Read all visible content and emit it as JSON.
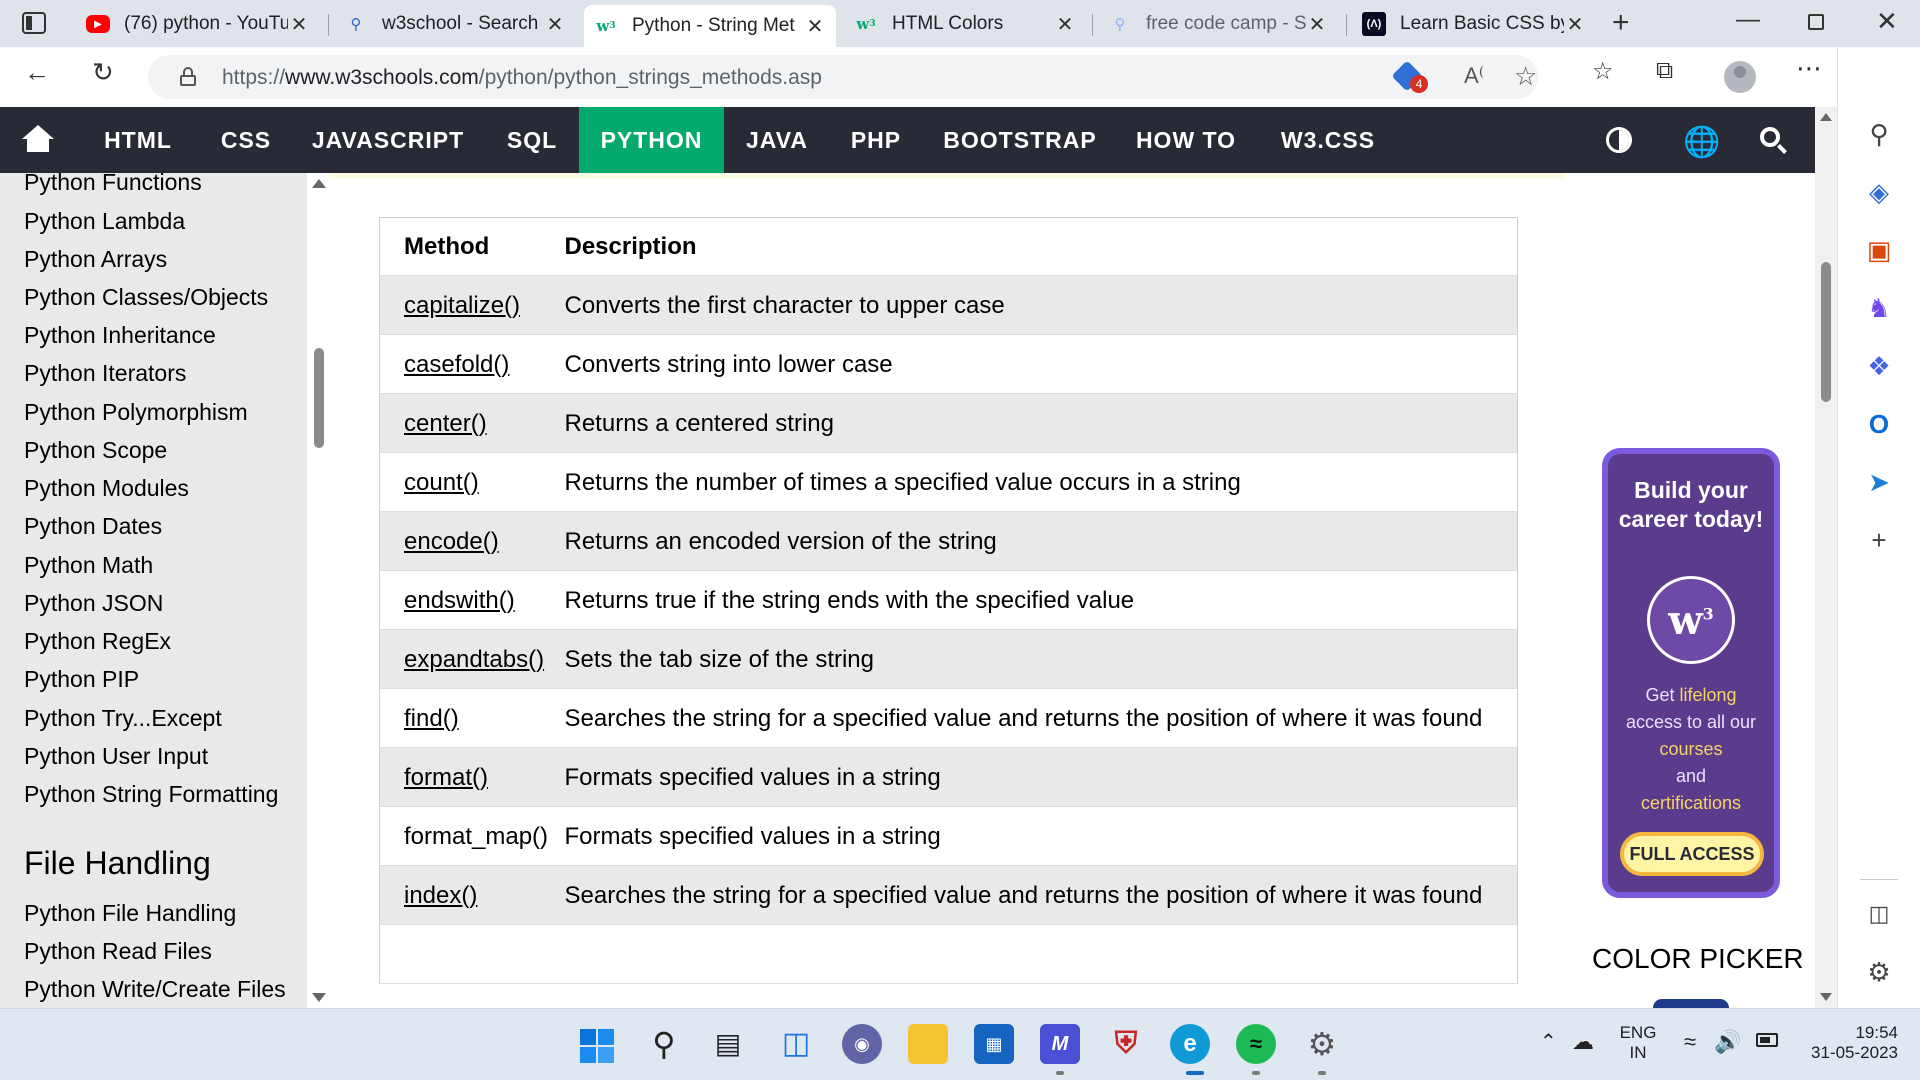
{
  "browser": {
    "tabs": [
      {
        "favicon": "youtube-icon",
        "title": "(76) python - YouTu",
        "active": false
      },
      {
        "favicon": "search-icon",
        "title": "w3school - Search",
        "active": false
      },
      {
        "favicon": "w3schools-icon",
        "title": "Python - String Met",
        "active": true
      },
      {
        "favicon": "w3schools-icon",
        "title": "HTML Colors",
        "active": false
      },
      {
        "favicon": "search-icon",
        "title": "free code camp - Se",
        "active": false
      },
      {
        "favicon": "freecodecamp-icon",
        "title": "Learn Basic CSS by",
        "active": false
      }
    ],
    "url_prefix": "https://",
    "url_host": "www.w3schools.com",
    "url_path": "/python/python_strings_methods.asp",
    "extension_badge": "4"
  },
  "topnav": {
    "items": [
      "HTML",
      "CSS",
      "JAVASCRIPT",
      "SQL",
      "PYTHON",
      "JAVA",
      "PHP",
      "BOOTSTRAP",
      "HOW TO",
      "W3.CSS"
    ],
    "active": "PYTHON"
  },
  "sidebar": {
    "links": [
      "Python Functions",
      "Python Lambda",
      "Python Arrays",
      "Python Classes/Objects",
      "Python Inheritance",
      "Python Iterators",
      "Python Polymorphism",
      "Python Scope",
      "Python Modules",
      "Python Dates",
      "Python Math",
      "Python JSON",
      "Python RegEx",
      "Python PIP",
      "Python Try...Except",
      "Python User Input",
      "Python String Formatting"
    ],
    "section_heading": "File Handling",
    "section_links": [
      "Python File Handling",
      "Python Read Files",
      "Python Write/Create Files"
    ]
  },
  "table": {
    "headers": [
      "Method",
      "Description"
    ],
    "rows": [
      {
        "method": "capitalize()",
        "link": true,
        "description": "Converts the first character to upper case"
      },
      {
        "method": "casefold()",
        "link": true,
        "description": "Converts string into lower case"
      },
      {
        "method": "center()",
        "link": true,
        "description": "Returns a centered string"
      },
      {
        "method": "count()",
        "link": true,
        "description": "Returns the number of times a specified value occurs in a string"
      },
      {
        "method": "encode()",
        "link": true,
        "description": "Returns an encoded version of the string"
      },
      {
        "method": "endswith()",
        "link": true,
        "description": "Returns true if the string ends with the specified value"
      },
      {
        "method": "expandtabs()",
        "link": true,
        "description": "Sets the tab size of the string"
      },
      {
        "method": "find()",
        "link": true,
        "description": "Searches the string for a specified value and returns the position of where it was found"
      },
      {
        "method": "format()",
        "link": true,
        "description": "Formats specified values in a string"
      },
      {
        "method": "format_map()",
        "link": false,
        "description": "Formats specified values in a string"
      },
      {
        "method": "index()",
        "link": true,
        "description": "Searches the string for a specified value and returns the position of where it was found"
      }
    ]
  },
  "ad": {
    "title": "Build your career today!",
    "text_1": "Get ",
    "text_hl1": "lifelong",
    "text_2": "access to all our",
    "text_hl2": "courses",
    "text_3": "and",
    "text_hl3": "certifications",
    "button": "FULL ACCESS"
  },
  "color_picker": "COLOR PICKER",
  "taskbar": {
    "lang_1": "ENG",
    "lang_2": "IN",
    "time": "19:54",
    "date": "31-05-2023"
  },
  "colors": {
    "nav_bg": "#282a35",
    "nav_active": "#04aa6d",
    "sidebar_bg": "#e7e9eb",
    "ad_bg": "#5b3b8c",
    "ad_button": "#fff4a3"
  }
}
